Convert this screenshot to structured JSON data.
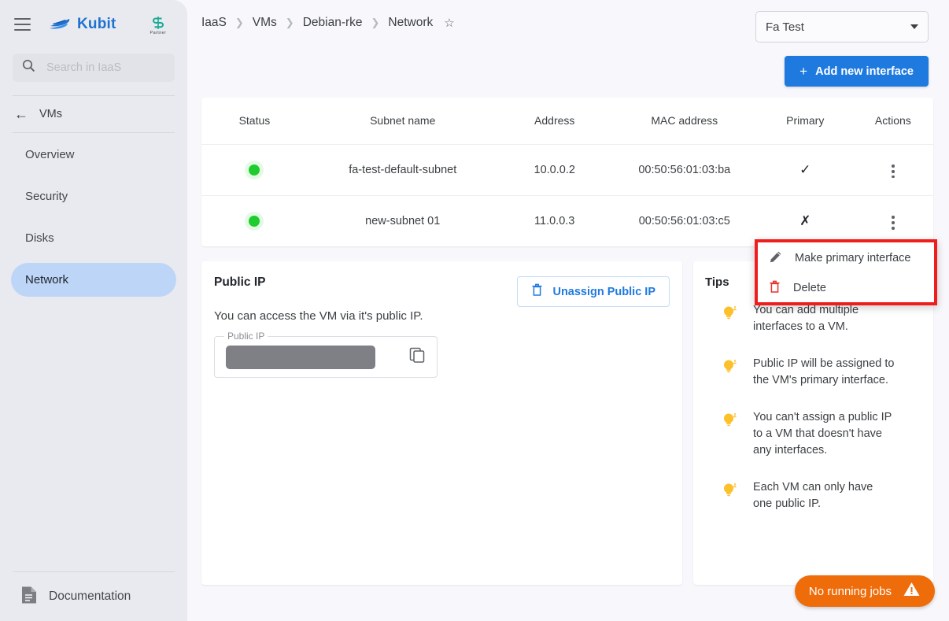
{
  "sidebar": {
    "menu_icon": "hamburger-icon",
    "brand": {
      "name": "Kubit",
      "logo_icon": "kubit-boat-logo",
      "color": "#1f72d0"
    },
    "partner_logo": {
      "icon": "partner-s-logo",
      "subtext": "Partner",
      "color": "#1aab94"
    },
    "search": {
      "placeholder": "Search in IaaS",
      "value": "",
      "icon": "search-icon"
    },
    "back": {
      "label": "VMs",
      "icon": "arrow-left-icon"
    },
    "items": [
      {
        "label": "Overview",
        "active": false
      },
      {
        "label": "Security",
        "active": false
      },
      {
        "label": "Disks",
        "active": false
      },
      {
        "label": "Network",
        "active": true
      }
    ],
    "active_color": "#bdd6f8",
    "documentation": {
      "label": "Documentation",
      "icon": "document-icon"
    }
  },
  "topbar": {
    "breadcrumb": [
      "IaaS",
      "VMs",
      "Debian-rke",
      "Network"
    ],
    "breadcrumb_separator": "❯",
    "favorite_icon": "star-outline-icon",
    "project_select": {
      "value": "Fa Test",
      "icon": "chevron-down-icon"
    },
    "add_button": {
      "label": "Add new interface",
      "icon": "plus-icon",
      "color": "#1f7ae0"
    }
  },
  "table": {
    "columns": [
      "Status",
      "Subnet name",
      "Address",
      "MAC address",
      "Primary",
      "Actions"
    ],
    "rows": [
      {
        "status": "running",
        "status_color": "#1ecc2e",
        "subnet_name": "fa-test-default-subnet",
        "address": "10.0.0.2",
        "mac_address": "00:50:56:01:03:ba",
        "primary": "✓",
        "actions_icon": "kebab-menu-icon"
      },
      {
        "status": "running",
        "status_color": "#1ecc2e",
        "subnet_name": "new-subnet 01",
        "address": "11.0.0.3",
        "mac_address": "00:50:56:01:03:c5",
        "primary": "✗",
        "actions_icon": "kebab-menu-icon"
      }
    ]
  },
  "context_menu": {
    "highlight_color": "#f01d1d",
    "items": [
      {
        "label": "Make primary interface",
        "icon": "pencil-icon",
        "icon_color": "#5f6368"
      },
      {
        "label": "Delete",
        "icon": "trash-icon",
        "icon_color": "#e8322a"
      }
    ]
  },
  "public_ip": {
    "title": "Public IP",
    "unassign_button": {
      "label": "Unassign Public IP",
      "icon": "trash-icon",
      "color": "#1f7ae0"
    },
    "description": "You can access the VM via it's public IP.",
    "field": {
      "label": "Public IP",
      "value": "",
      "redacted": true,
      "copy_icon": "copy-icon"
    }
  },
  "tips": {
    "title": "Tips",
    "bulb_icon": "lightbulb-icon",
    "bulb_color": "#fcc02a",
    "items": [
      "You can add multiple interfaces to a VM.",
      "Public IP will be assigned to the VM's primary interface.",
      "You can't assign a public IP to a VM that doesn't have any interfaces.",
      "Each VM can only have one public IP."
    ]
  },
  "jobs": {
    "label": "No running jobs",
    "icon": "warning-triangle-icon",
    "color": "#ef6c0a"
  }
}
